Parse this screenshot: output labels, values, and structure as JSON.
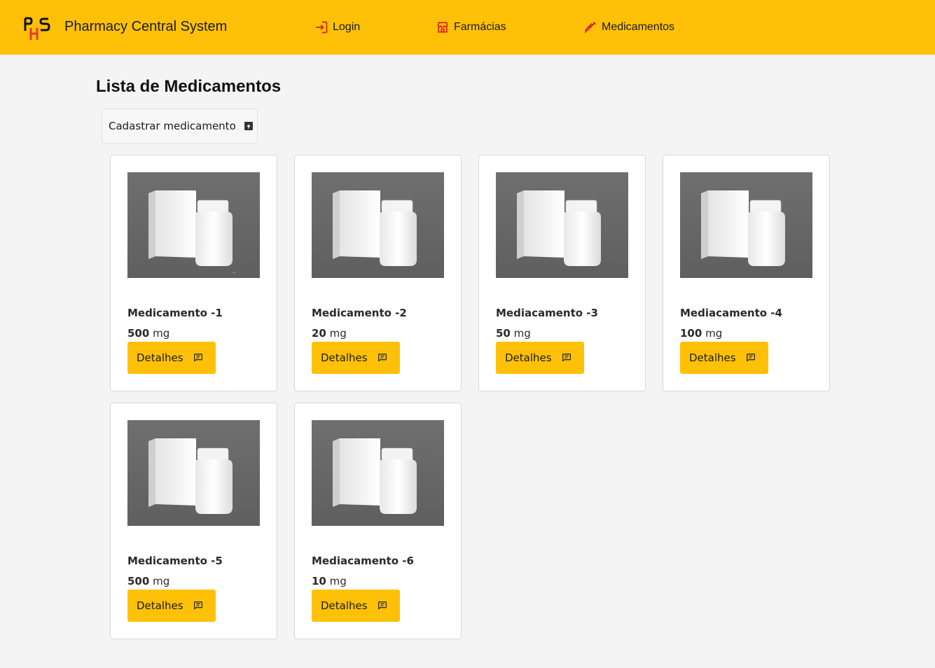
{
  "header": {
    "logo_text": "PHS",
    "title": "Pharmacy Central System",
    "nav": [
      {
        "label": "Login",
        "icon": "login-icon"
      },
      {
        "label": "Farmácias",
        "icon": "store-icon"
      },
      {
        "label": "Medicamentos",
        "icon": "syringe-icon"
      }
    ]
  },
  "page": {
    "title": "Lista de Medicamentos",
    "add_button": "Cadastrar medicamento",
    "add_icon": "add-box-icon"
  },
  "details_label": "Detalhes",
  "unit": "mg",
  "medicines": [
    {
      "name": "Medicamento -1",
      "dose": "500"
    },
    {
      "name": "Medicamento -2",
      "dose": "20"
    },
    {
      "name": "Mediacamento -3",
      "dose": "50"
    },
    {
      "name": "Mediacamento -4",
      "dose": "100"
    },
    {
      "name": "Medicamento -5",
      "dose": "500"
    },
    {
      "name": "Mediacamento -6",
      "dose": "10"
    }
  ],
  "colors": {
    "accent": "#ffc107",
    "nav_icon": "#d81b1b",
    "background": "#f4f4f4"
  }
}
